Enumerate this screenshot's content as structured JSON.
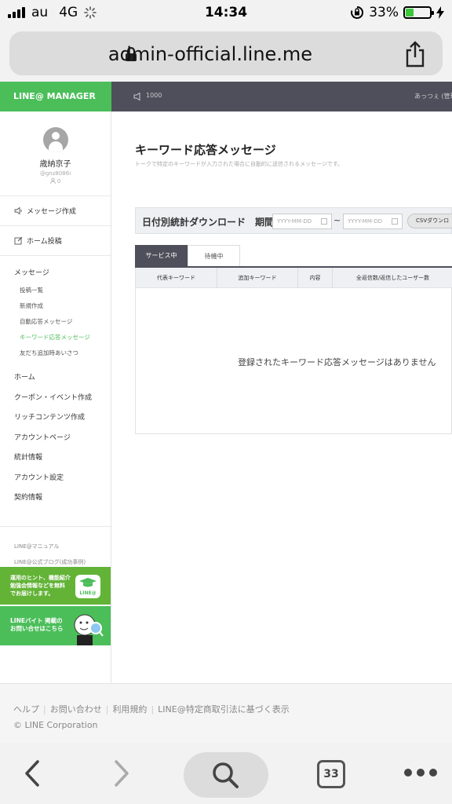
{
  "status_bar": {
    "carrier": "au",
    "network": "4G",
    "time": "14:34",
    "battery": "33%",
    "battery_level": 0.33
  },
  "browser": {
    "url": "admin-official.line.me",
    "tab_count": "33"
  },
  "header": {
    "logo": "LINE@ MANAGER",
    "count": "1000",
    "user": "あっつぇ (管理"
  },
  "profile": {
    "name": "歳納京子",
    "id": "@gnz8086i",
    "friends": "0"
  },
  "sidebar": {
    "message_create": "メッセージ作成",
    "home_post": "ホーム投稿",
    "messages_title": "メッセージ",
    "message_subitems": [
      "投稿一覧",
      "新規作成",
      "自動応答メッセージ",
      "キーワード応答メッセージ",
      "友だち追加時あいさつ"
    ],
    "menu_items": [
      "ホーム",
      "クーポン・イベント作成",
      "リッチコンテンツ作成",
      "アカウントページ",
      "統計情報",
      "アカウント設定",
      "契約情報"
    ],
    "links": [
      "LINE@マニュアル",
      "LINE@公式ブログ(成功事例)"
    ],
    "banner1_text": [
      "運用のヒント、機能紹介",
      "勉強会情報などを無料",
      "でお届けします。"
    ],
    "banner1_logo": "LINE@",
    "banner2_text": [
      "LINEバイト 掲載の",
      "お問い合せはこちら"
    ]
  },
  "main": {
    "title": "キーワード応答メッセージ",
    "subtitle": "トークで特定のキーワードが入力された場合に自動的に送信されるメッセージです。",
    "stats_label": "日付別統計ダウンロード　期間",
    "date_placeholder": "YYYY-MM-DD",
    "tilde": "~",
    "csv_button": "CSVダウンロ",
    "tabs": [
      "サービス中",
      "待機中"
    ],
    "columns": [
      "代表キーワード",
      "追加キーワード",
      "内容",
      "全返信数/返信したユーザー数"
    ],
    "empty_message": "登録されたキーワード応答メッセージはありません"
  },
  "footer": {
    "links": [
      "ヘルプ",
      "お問い合わせ",
      "利用規約",
      "LINE@特定商取引法に基づく表示"
    ],
    "copyright": "© LINE Corporation"
  },
  "colors": {
    "brand_green": "#4bbe5a",
    "header_dark": "#4e4f5a",
    "banner_green": "#63b337"
  }
}
